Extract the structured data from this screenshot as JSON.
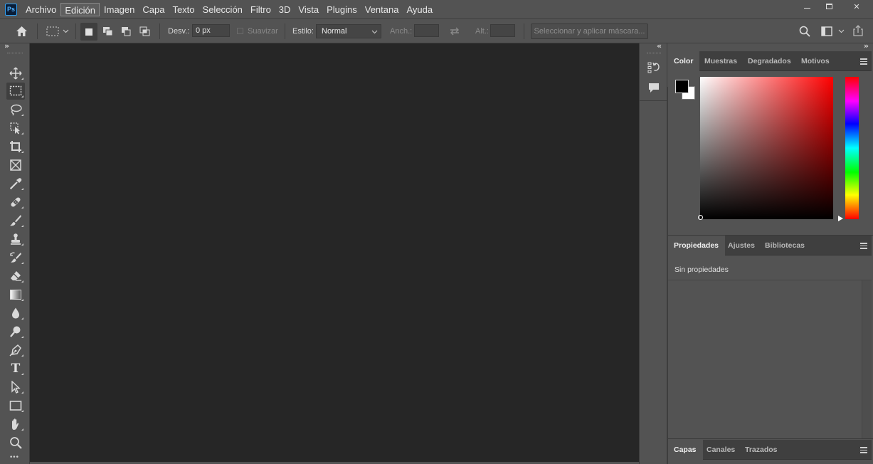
{
  "app": {
    "logo_text": "Ps"
  },
  "menubar": {
    "items": [
      "Archivo",
      "Edición",
      "Imagen",
      "Capa",
      "Texto",
      "Selección",
      "Filtro",
      "3D",
      "Vista",
      "Plugins",
      "Ventana",
      "Ayuda"
    ],
    "active_index": 1
  },
  "window_controls": {
    "minimize": "—",
    "maximize": "☐",
    "close": "✕"
  },
  "options_bar": {
    "feather_label": "Desv.:",
    "feather_value": "0 px",
    "antialias_label": "Suavizar",
    "style_label": "Estilo:",
    "style_value": "Normal",
    "width_label": "Anch.:",
    "height_label": "Alt.:",
    "mask_button": "Seleccionar y aplicar máscara..."
  },
  "toolbar": {
    "collapse_glyph": "»",
    "tools": [
      {
        "name": "move-tool",
        "icon": "move-icon"
      },
      {
        "name": "marquee-tool",
        "icon": "rect-marquee-icon"
      },
      {
        "name": "lasso-tool",
        "icon": "lasso-icon"
      },
      {
        "name": "object-select-tool",
        "icon": "object-select-icon"
      },
      {
        "name": "crop-tool",
        "icon": "crop-icon"
      },
      {
        "name": "frame-tool",
        "icon": "frame-icon"
      },
      {
        "name": "eyedropper-tool",
        "icon": "eyedropper-icon"
      },
      {
        "name": "healing-brush-tool",
        "icon": "bandage-icon"
      },
      {
        "name": "brush-tool",
        "icon": "brush-icon"
      },
      {
        "name": "clone-stamp-tool",
        "icon": "stamp-icon"
      },
      {
        "name": "history-brush-tool",
        "icon": "history-brush-icon"
      },
      {
        "name": "eraser-tool",
        "icon": "eraser-icon"
      },
      {
        "name": "gradient-tool",
        "icon": "gradient-icon"
      },
      {
        "name": "blur-tool",
        "icon": "drop-icon"
      },
      {
        "name": "dodge-tool",
        "icon": "dodge-icon"
      },
      {
        "name": "pen-tool",
        "icon": "pen-icon"
      },
      {
        "name": "type-tool",
        "icon": "type-icon"
      },
      {
        "name": "path-select-tool",
        "icon": "arrow-icon"
      },
      {
        "name": "rectangle-tool",
        "icon": "rectangle-icon"
      },
      {
        "name": "hand-tool",
        "icon": "hand-icon"
      },
      {
        "name": "zoom-tool",
        "icon": "zoom-icon"
      }
    ],
    "type_glyph": "T",
    "more_glyph": "•••"
  },
  "ministrip": {
    "collapse_glyph": "«"
  },
  "panels": {
    "collapse_glyph": "»",
    "color": {
      "tabs": [
        "Color",
        "Muestras",
        "Degradados",
        "Motivos"
      ],
      "active_index": 0,
      "foreground": "#000000",
      "background": "#ffffff",
      "hue_color": "#ff0000"
    },
    "properties": {
      "tabs": [
        "Propiedades",
        "Ajustes",
        "Bibliotecas"
      ],
      "active_index": 0,
      "empty_text": "Sin propiedades"
    },
    "layers": {
      "tabs": [
        "Capas",
        "Canales",
        "Trazados"
      ],
      "active_index": 0
    }
  }
}
